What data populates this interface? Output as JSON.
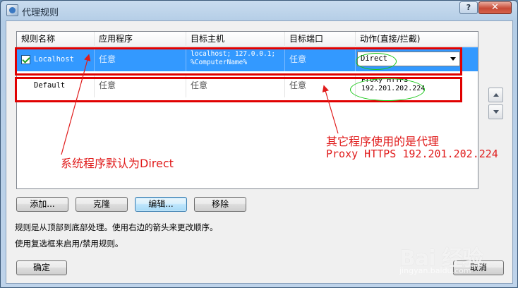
{
  "window": {
    "title": "代理规则",
    "help_label": "?",
    "close_label": "✕"
  },
  "table": {
    "columns": [
      "规则名称",
      "应用程序",
      "目标主机",
      "目标端口",
      "动作(直接/拦截)"
    ],
    "rows": [
      {
        "checked": true,
        "name": "Localhost",
        "application": "任意",
        "host_line1": "localhost; 127.0.0.1;",
        "host_line2": "%ComputerName%",
        "port": "任意",
        "action": "Direct"
      },
      {
        "checked": false,
        "name": "Default",
        "application": "任意",
        "host": "任意",
        "port": "任意",
        "action_line1": "Proxy HTTPS",
        "action_line2": "192.201.202.224"
      }
    ]
  },
  "annotations": {
    "left": "系统程序默认为Direct",
    "right_line1": "其它程序使用的是代理",
    "right_line2": "Proxy HTTPS 192.201.202.224"
  },
  "buttons": {
    "add": "添加...",
    "clone": "克隆",
    "edit": "编辑...",
    "remove": "移除",
    "ok": "确定",
    "cancel": "取消"
  },
  "help": {
    "line1": "规则是从顶部到底部处理。使用右边的箭头来更改顺序。",
    "line2": "使用复选框来启用/禁用规则。"
  },
  "watermark": {
    "logo": "Bai 经验",
    "url": "jingyan.baidu.com"
  },
  "colors": {
    "selection": "#3399ff",
    "annotation": "#e01b1b",
    "highlight_ellipse": "#19c819"
  }
}
